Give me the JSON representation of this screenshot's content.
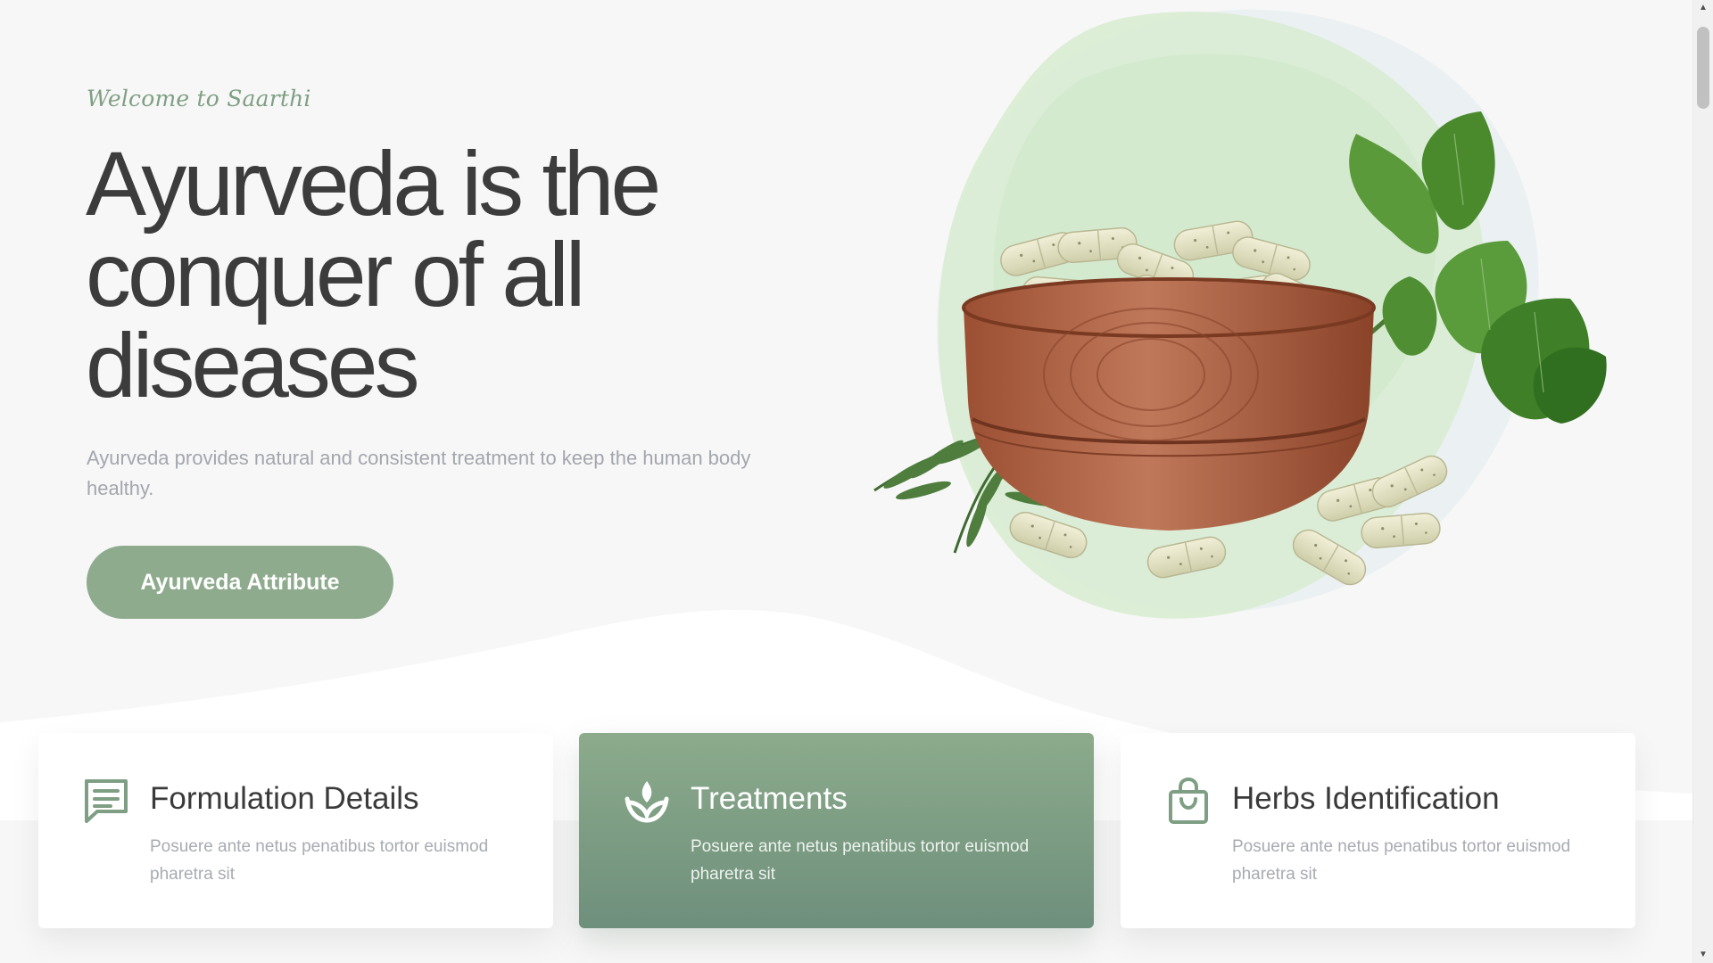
{
  "hero": {
    "eyebrow": "Welcome to Saarthi",
    "headline": "Ayurveda is the conquer of all diseases",
    "subtitle": "Ayurveda provides natural and consistent treatment to keep the human body healthy.",
    "cta_label": "Ayurveda Attribute"
  },
  "illustration": {
    "subject": "wooden bowl of herbal capsules with green leaves"
  },
  "features": [
    {
      "icon": "message-icon",
      "title": "Formulation Details",
      "text": "Posuere ante netus penatibus tortor euismod pharetra sit",
      "active": false
    },
    {
      "icon": "lotus-icon",
      "title": "Treatments",
      "text": "Posuere ante netus penatibus tortor euismod pharetra sit",
      "active": true
    },
    {
      "icon": "shopping-bag-icon",
      "title": "Herbs Identification",
      "text": "Posuere ante netus penatibus tortor euismod pharetra sit",
      "active": false
    }
  ],
  "colors": {
    "accent": "#8fab8e",
    "accent_dark": "#6e8f7c",
    "heading": "#3c3c3c",
    "muted": "#a3a6ad",
    "background": "#f7f7f7"
  }
}
